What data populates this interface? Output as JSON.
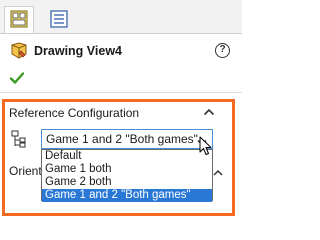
{
  "tabs": [
    {
      "icon": "property-manager-icon"
    },
    {
      "icon": "feature-tree-icon"
    }
  ],
  "header": {
    "title": "Drawing View4",
    "help_icon": "?"
  },
  "reference_configuration": {
    "label": "Reference Configuration",
    "selected_value": "Game 1 and 2 \"Both games\"",
    "options": [
      "Default",
      "Game 1 both",
      "Game 2 both",
      "Game 1 and 2 \"Both games\""
    ],
    "selected_index": 3
  },
  "orientation": {
    "label": "Orient"
  },
  "colors": {
    "highlight": "#f26a24",
    "selection": "#2a78d6",
    "ok_green": "#3a9d23"
  }
}
